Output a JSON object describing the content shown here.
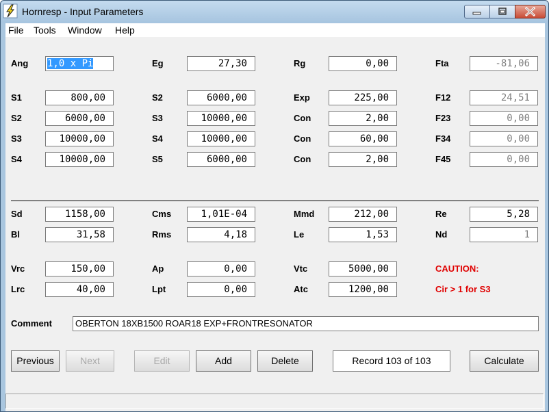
{
  "window": {
    "title": "Hornresp - Input Parameters"
  },
  "menu": [
    "File",
    "Tools",
    "Window",
    "Help"
  ],
  "row1": [
    {
      "label": "Ang",
      "value": "1,0 x Pi"
    },
    {
      "label": "Eg",
      "value": "27,30"
    },
    {
      "label": "Rg",
      "value": "0,00"
    },
    {
      "label": "Fta",
      "value": "-81,06"
    }
  ],
  "horn": [
    [
      {
        "label": "S1",
        "value": "800,00"
      },
      {
        "label": "S2",
        "value": "6000,00"
      },
      {
        "label": "Exp",
        "value": "225,00"
      },
      {
        "label": "F12",
        "value": "24,51"
      }
    ],
    [
      {
        "label": "S2",
        "value": "6000,00"
      },
      {
        "label": "S3",
        "value": "10000,00"
      },
      {
        "label": "Con",
        "value": "2,00"
      },
      {
        "label": "F23",
        "value": "0,00"
      }
    ],
    [
      {
        "label": "S3",
        "value": "10000,00"
      },
      {
        "label": "S4",
        "value": "10000,00"
      },
      {
        "label": "Con",
        "value": "60,00"
      },
      {
        "label": "F34",
        "value": "0,00"
      }
    ],
    [
      {
        "label": "S4",
        "value": "10000,00"
      },
      {
        "label": "S5",
        "value": "6000,00"
      },
      {
        "label": "Con",
        "value": "2,00"
      },
      {
        "label": "F45",
        "value": "0,00"
      }
    ]
  ],
  "driver": [
    [
      {
        "label": "Sd",
        "value": "1158,00"
      },
      {
        "label": "Cms",
        "value": "1,01E-04"
      },
      {
        "label": "Mmd",
        "value": "212,00"
      },
      {
        "label": "Re",
        "value": "5,28"
      }
    ],
    [
      {
        "label": "Bl",
        "value": "31,58"
      },
      {
        "label": "Rms",
        "value": "4,18"
      },
      {
        "label": "Le",
        "value": "1,53"
      },
      {
        "label": "Nd",
        "value": "1"
      }
    ]
  ],
  "chamber": [
    [
      {
        "label": "Vrc",
        "value": "150,00"
      },
      {
        "label": "Ap",
        "value": "0,00"
      },
      {
        "label": "Vtc",
        "value": "5000,00"
      }
    ],
    [
      {
        "label": "Lrc",
        "value": "40,00"
      },
      {
        "label": "Lpt",
        "value": "0,00"
      },
      {
        "label": "Atc",
        "value": "1200,00"
      }
    ]
  ],
  "caution": {
    "title": "CAUTION:",
    "message": "Cir > 1 for S3",
    "color": "#e00000"
  },
  "comment": {
    "label": "Comment",
    "value": "OBERTON 18XB1500 ROAR18 EXP+FRONTRESONATOR"
  },
  "buttons": {
    "previous": "Previous",
    "next": "Next",
    "edit": "Edit",
    "add": "Add",
    "delete": "Delete",
    "calculate": "Calculate"
  },
  "record": "Record 103 of 103",
  "icons": {
    "app": "hornresp-lightning-icon",
    "minimize": "minimize-icon",
    "maximize": "maximize-icon",
    "close": "close-icon"
  }
}
